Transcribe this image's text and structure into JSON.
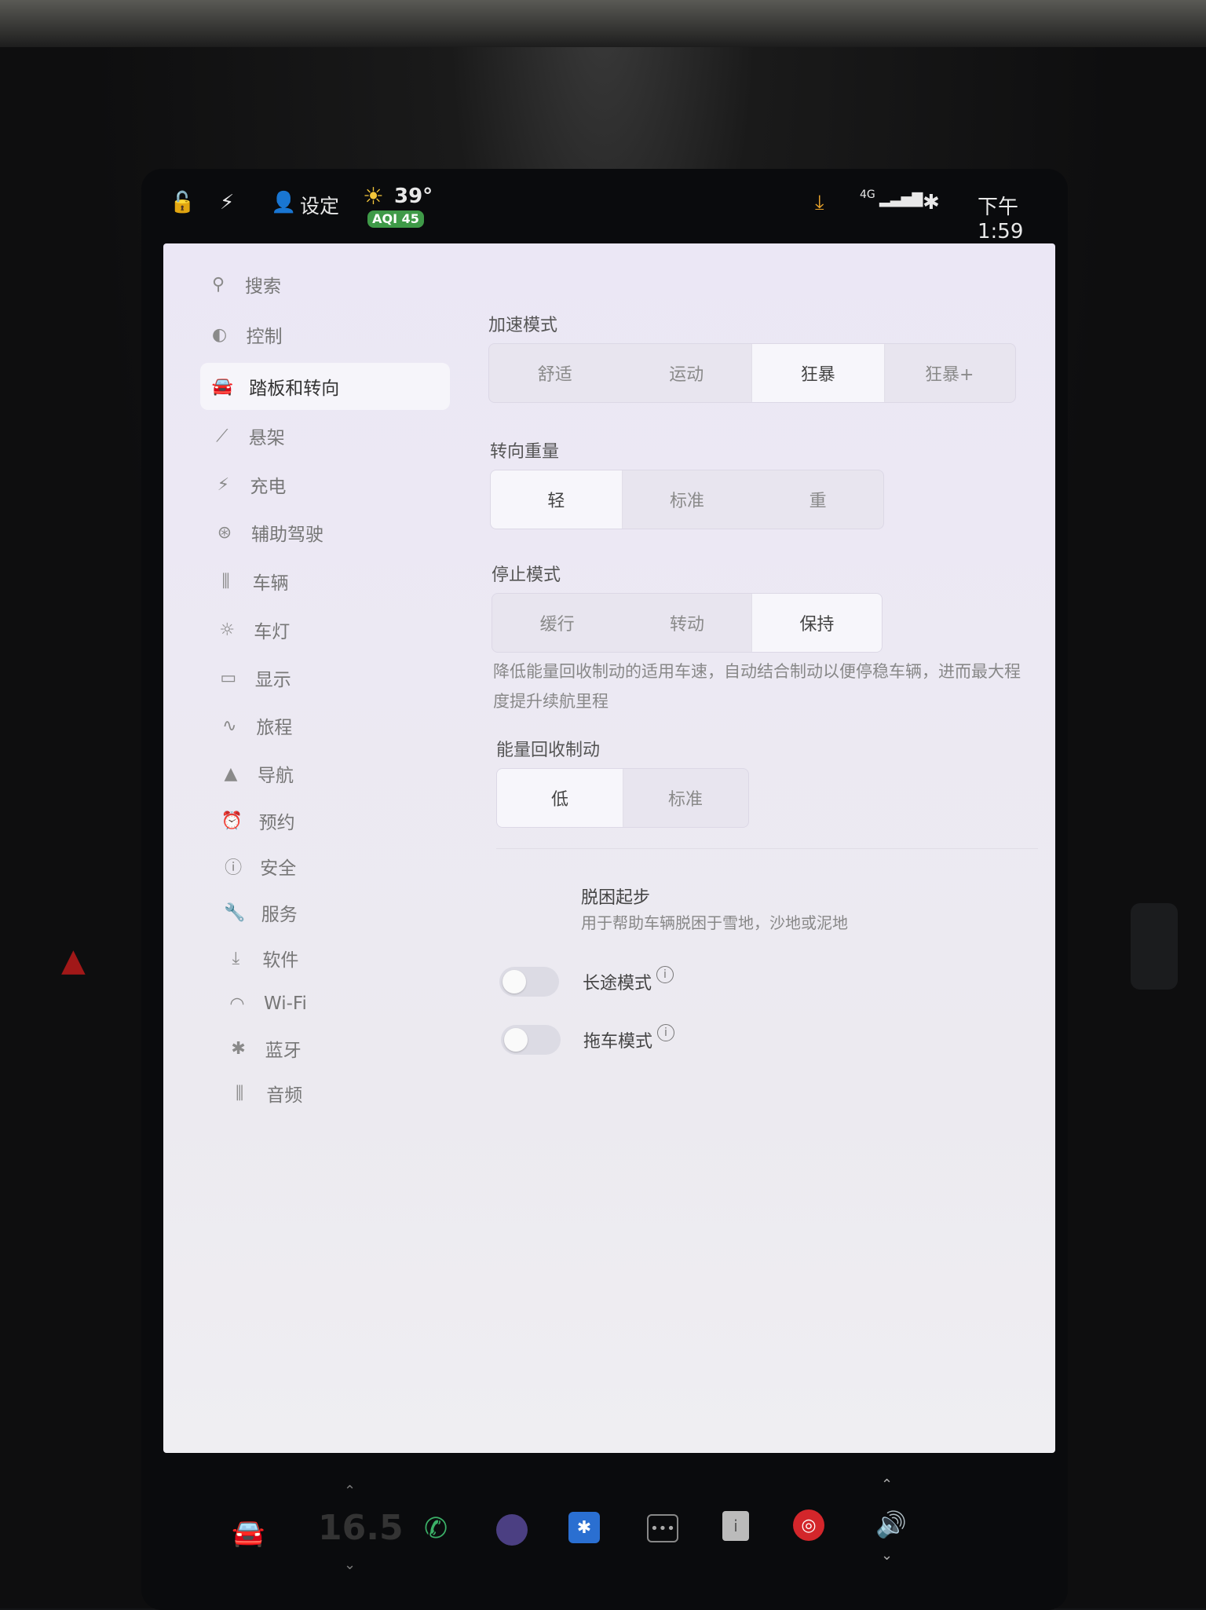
{
  "statusbar": {
    "settings_label": "设定",
    "temperature": "39°",
    "aqi": "AQI 45",
    "network": "4G",
    "time": "下午1:59"
  },
  "sidebar": {
    "items": [
      {
        "icon": "search-icon",
        "glyph": "⚲",
        "label": "搜索"
      },
      {
        "icon": "toggle-icon",
        "glyph": "◐",
        "label": "控制"
      },
      {
        "icon": "car-icon",
        "glyph": "🚘",
        "label": "踏板和转向"
      },
      {
        "icon": "suspension-icon",
        "glyph": "⟋",
        "label": "悬架"
      },
      {
        "icon": "bolt-icon",
        "glyph": "⚡",
        "label": "充电"
      },
      {
        "icon": "steering-wheel-icon",
        "glyph": "⊛",
        "label": "辅助驾驶"
      },
      {
        "icon": "sliders-icon",
        "glyph": "⫼",
        "label": "车辆"
      },
      {
        "icon": "light-icon",
        "glyph": "☼",
        "label": "车灯"
      },
      {
        "icon": "display-icon",
        "glyph": "▭",
        "label": "显示"
      },
      {
        "icon": "trip-icon",
        "glyph": "∿",
        "label": "旅程"
      },
      {
        "icon": "navigation-icon",
        "glyph": "▲",
        "label": "导航"
      },
      {
        "icon": "alarm-icon",
        "glyph": "⏰",
        "label": "预约"
      },
      {
        "icon": "safety-icon",
        "glyph": "ⓘ",
        "label": "安全"
      },
      {
        "icon": "wrench-icon",
        "glyph": "🔧",
        "label": "服务"
      },
      {
        "icon": "download-icon",
        "glyph": "⤓",
        "label": "软件"
      },
      {
        "icon": "wifi-icon",
        "glyph": "◠",
        "label": "Wi-Fi"
      },
      {
        "icon": "bluetooth-icon",
        "glyph": "✱",
        "label": "蓝牙"
      },
      {
        "icon": "audio-icon",
        "glyph": "⫼",
        "label": "音频"
      }
    ],
    "active_index": 2
  },
  "acceleration": {
    "title": "加速模式",
    "options": [
      "舒适",
      "运动",
      "狂暴",
      "狂暴+"
    ],
    "selected": 2
  },
  "steering": {
    "title": "转向重量",
    "options": [
      "轻",
      "标准",
      "重"
    ],
    "selected": 0
  },
  "stop_mode": {
    "title": "停止模式",
    "options": [
      "缓行",
      "转动",
      "保持"
    ],
    "selected": 2,
    "description": "降低能量回收制动的适用车速，自动结合制动以便停稳车辆，进而最大程度提升续航里程"
  },
  "regen": {
    "title": "能量回收制动",
    "options": [
      "低",
      "标准"
    ],
    "selected": 0
  },
  "offroad": {
    "title": "脱困起步",
    "description": "用于帮助车辆脱困于雪地，沙地或泥地"
  },
  "toggles": {
    "long_trip": "长途模式",
    "tow": "拖车模式"
  },
  "dock": {
    "temperature": "16.5"
  }
}
